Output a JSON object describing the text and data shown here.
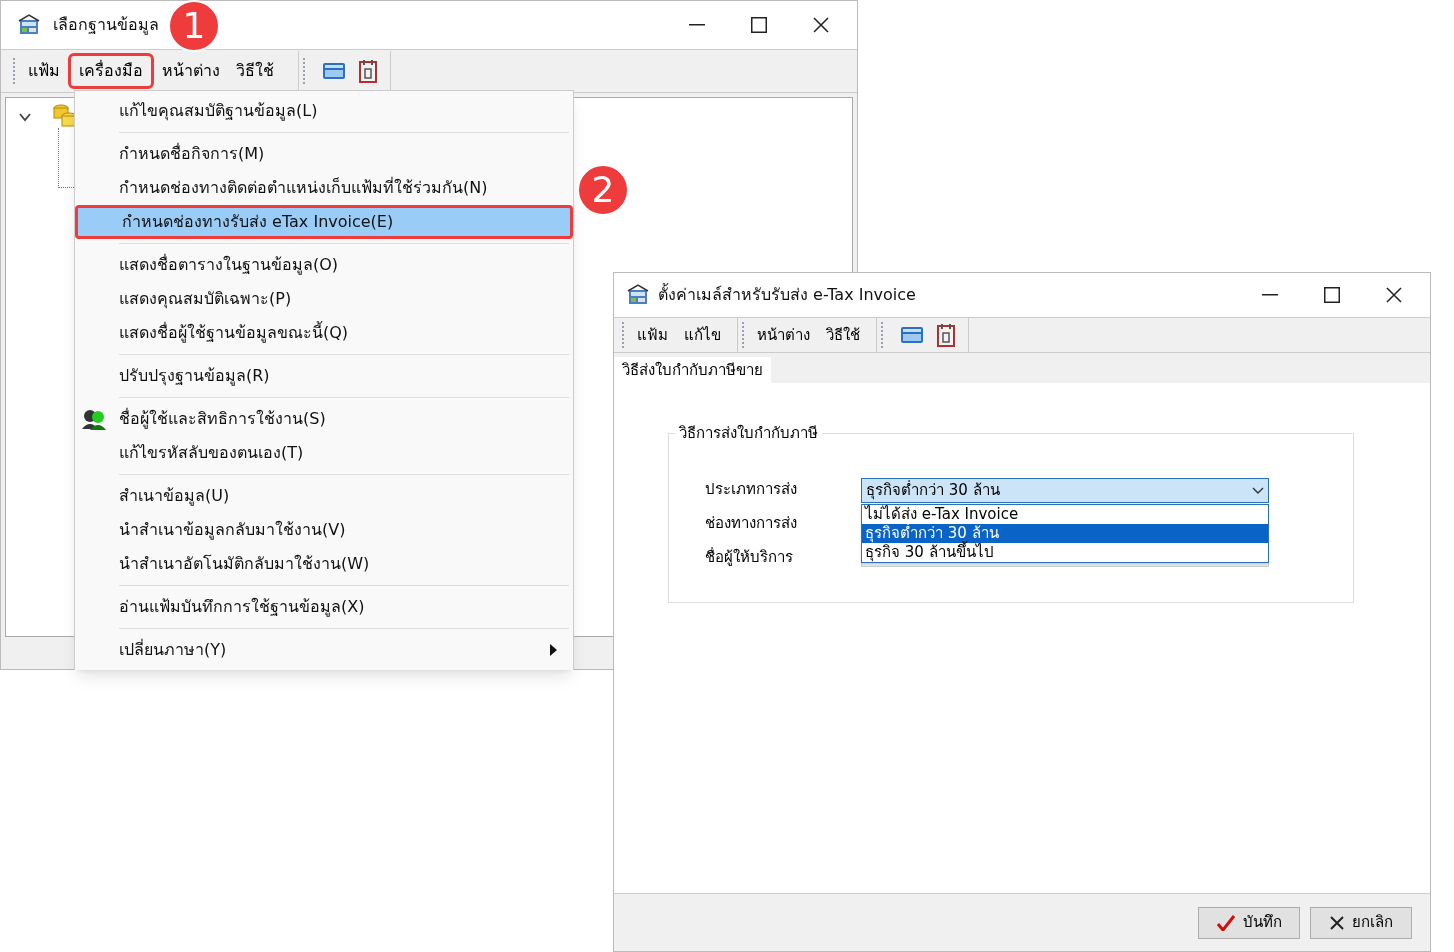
{
  "annotations": [
    {
      "label": "1"
    },
    {
      "label": "2"
    }
  ],
  "main_window": {
    "title": "เลือกฐานข้อมูล",
    "menu_bar": [
      {
        "label": "แฟ้ม",
        "selected": false
      },
      {
        "label": "เครื่องมือ",
        "selected": true
      },
      {
        "label": "หน้าต่าง",
        "selected": false
      },
      {
        "label": "วิธีใช้",
        "selected": false
      }
    ],
    "tree": {
      "expanded": true
    }
  },
  "tools_menu": {
    "groups": [
      [
        {
          "label": "แก้ไขคุณสมบัติฐานข้อมูล(L)",
          "selected": false,
          "kind": "plain"
        }
      ],
      [
        {
          "label": "กำหนดชื่อกิจการ(M)",
          "selected": false,
          "kind": "plain"
        },
        {
          "label": "กำหนดช่องทางติดต่อตำแหน่งเก็บแฟ้มที่ใช้ร่วมกัน(N)",
          "selected": false,
          "kind": "plain"
        },
        {
          "label": "กำหนดช่องทางรับส่ง eTax Invoice(E)",
          "selected": true,
          "kind": "plain"
        }
      ],
      [
        {
          "label": "แสดงชื่อตารางในฐานข้อมูล(O)",
          "selected": false,
          "kind": "plain"
        },
        {
          "label": "แสดงคุณสมบัติเฉพาะ(P)",
          "selected": false,
          "kind": "plain"
        },
        {
          "label": "แสดงชื่อผู้ใช้ฐานข้อมูลขณะนี้(Q)",
          "selected": false,
          "kind": "plain"
        }
      ],
      [
        {
          "label": "ปรับปรุงฐานข้อมูล(R)",
          "selected": false,
          "kind": "plain"
        }
      ],
      [
        {
          "label": "ชื่อผู้ใช้และสิทธิการใช้งาน(S)",
          "selected": false,
          "kind": "icon"
        },
        {
          "label": "แก้ไขรหัสลับของตนเอง(T)",
          "selected": false,
          "kind": "plain"
        }
      ],
      [
        {
          "label": "สำเนาข้อมูล(U)",
          "selected": false,
          "kind": "plain"
        },
        {
          "label": "นำสำเนาข้อมูลกลับมาใช้งาน(V)",
          "selected": false,
          "kind": "plain"
        },
        {
          "label": "นำสำเนาอัตโนมัติกลับมาใช้งาน(W)",
          "selected": false,
          "kind": "plain"
        }
      ],
      [
        {
          "label": "อ่านแฟ้มบันทึกการใช้ฐานข้อมูล(X)",
          "selected": false,
          "kind": "plain"
        }
      ],
      [
        {
          "label": "เปลี่ยนภาษา(Y)",
          "selected": false,
          "kind": "submenu"
        }
      ]
    ]
  },
  "etax_window": {
    "title": "ตั้งค่าเมล์สำหรับรับส่ง e-Tax Invoice",
    "menu_groups": [
      [
        "แฟ้ม",
        "แก้ไข"
      ],
      [
        "หน้าต่าง",
        "วิธีใช้"
      ]
    ],
    "tabs": [
      {
        "label": "วิธีส่งใบกำกับภาษีขาย",
        "selected": true
      }
    ],
    "group_title": "วิธีการส่งใบกำกับภาษี",
    "field_labels": [
      "ประเภทการส่ง",
      "ช่องทางการส่ง",
      "ชื่อผู้ให้บริการ"
    ],
    "dropdown": {
      "value": "ธุรกิจต่ำกว่า 30 ล้าน",
      "open": true,
      "options": [
        {
          "label": "ไม่ได้ส่ง e-Tax Invoice",
          "selected": false
        },
        {
          "label": "ธุรกิจต่ำกว่า 30 ล้าน",
          "selected": true
        },
        {
          "label": "ธุรกิจ 30 ล้านขึ้นไป",
          "selected": false
        }
      ]
    },
    "buttons": [
      {
        "label": "บันทึก",
        "kind": "save"
      },
      {
        "label": "ยกเลิก",
        "kind": "cancel"
      }
    ]
  }
}
